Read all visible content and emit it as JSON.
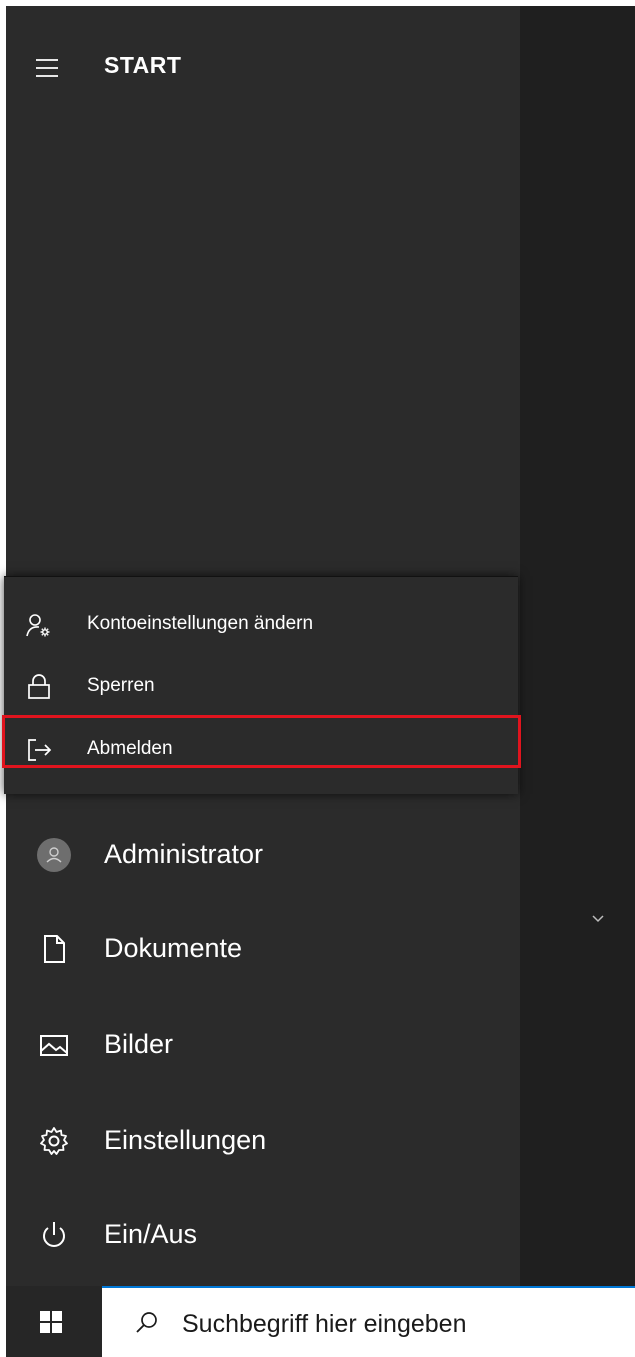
{
  "start": {
    "title": "START"
  },
  "user_flyout": {
    "items": [
      {
        "label": "Kontoeinstellungen ändern",
        "icon": "account-settings-icon"
      },
      {
        "label": "Sperren",
        "icon": "lock-icon"
      },
      {
        "label": "Abmelden",
        "icon": "sign-out-icon"
      }
    ]
  },
  "nav": {
    "items": [
      {
        "label": "Administrator",
        "icon": "avatar"
      },
      {
        "label": "Dokumente",
        "icon": "document-icon"
      },
      {
        "label": "Bilder",
        "icon": "pictures-icon"
      },
      {
        "label": "Einstellungen",
        "icon": "gear-icon"
      },
      {
        "label": "Ein/Aus",
        "icon": "power-icon"
      }
    ]
  },
  "taskbar": {
    "search_text": "Suchbegriff hier eingeben"
  },
  "colors": {
    "highlight": "#e0141e",
    "search_accent": "#0078d7",
    "rail_background": "#2b2b2b"
  }
}
